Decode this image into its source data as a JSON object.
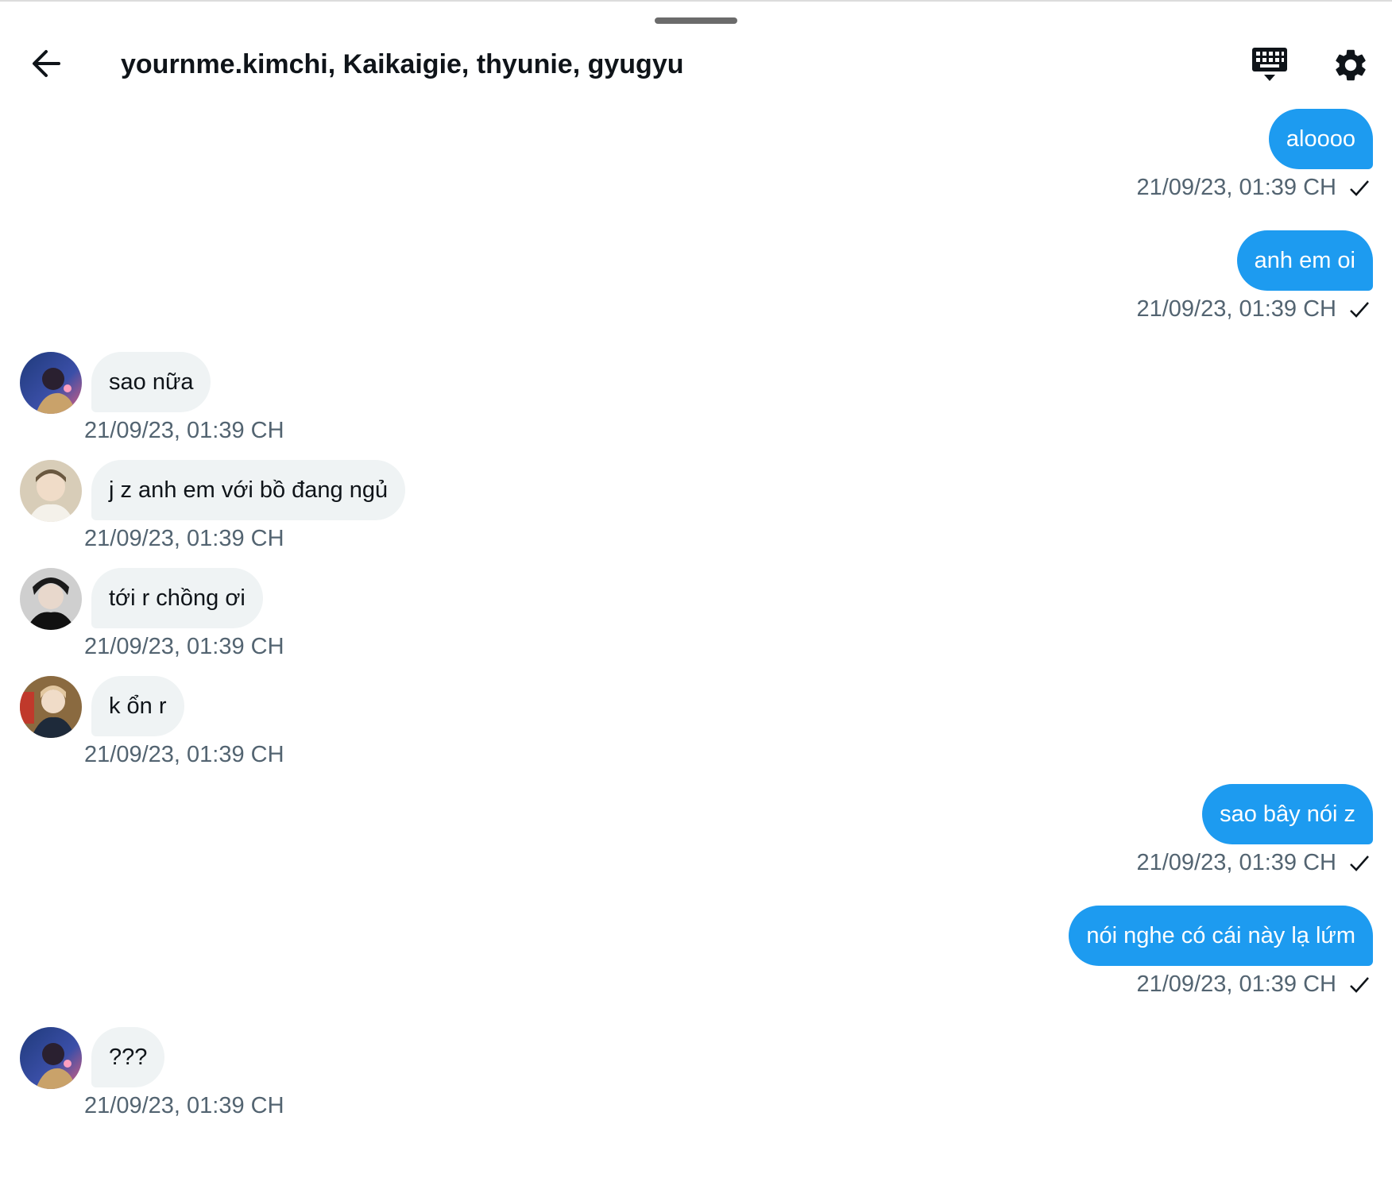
{
  "header": {
    "title": "yournme.kimchi, Kaikaigie, thyunie, gyugyu",
    "icons": [
      "back-arrow-icon",
      "keyboard-icon",
      "gear-icon"
    ]
  },
  "messages": [
    {
      "direction": "out",
      "text": "aloooo",
      "time": "21/09/23, 01:39 CH"
    },
    {
      "direction": "out",
      "text": "anh em oi",
      "time": "21/09/23, 01:39 CH"
    },
    {
      "direction": "in",
      "text": "sao nữa",
      "time": "21/09/23, 01:39 CH"
    },
    {
      "direction": "in",
      "text": "j z anh em với bồ đang ngủ",
      "time": "21/09/23, 01:39 CH"
    },
    {
      "direction": "in",
      "text": "tới r chồng ơi",
      "time": "21/09/23, 01:39 CH"
    },
    {
      "direction": "in",
      "text": "k ổn r",
      "time": "21/09/23, 01:39 CH"
    },
    {
      "direction": "out",
      "text": "sao bây nói z",
      "time": "21/09/23, 01:39 CH"
    },
    {
      "direction": "out",
      "text": "nói nghe có cái này lạ lứm",
      "time": "21/09/23, 01:39 CH"
    },
    {
      "direction": "in",
      "text": "???",
      "time": "21/09/23, 01:39 CH"
    }
  ],
  "colors": {
    "outgoing_bubble": "#1d9bf0",
    "incoming_bubble": "#eff3f4",
    "timestamp": "#536471"
  }
}
